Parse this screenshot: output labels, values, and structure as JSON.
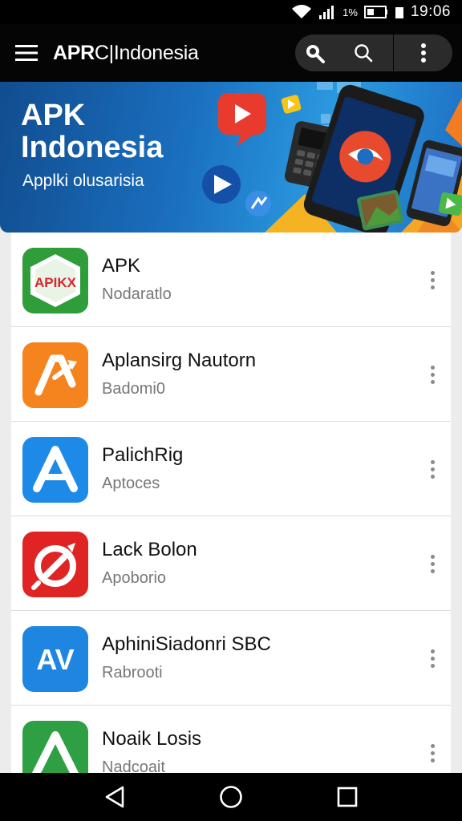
{
  "status_bar": {
    "battery_percent": "1%",
    "time": "19:06",
    "icons": [
      "wifi-icon",
      "signal-icon",
      "battery-icon"
    ]
  },
  "app_bar": {
    "title_bold": "APR",
    "title_sep": "C|",
    "title_rest": "Indonesia",
    "icons": [
      "menu-icon",
      "search-icon",
      "search-outline-icon",
      "more-vert-icon"
    ]
  },
  "banner": {
    "title_line1": "APK",
    "title_line2": "Indonesia",
    "subtitle": "Applki olusarisia"
  },
  "apps": [
    {
      "name": "APK",
      "subtitle": "Nodaratlo",
      "icon_text": "APIKX",
      "icon_color": "#2e9d3a"
    },
    {
      "name": "Aplansirg Nautorn",
      "subtitle": "Badomi0",
      "icon_text": "A",
      "icon_color": "#f5841f"
    },
    {
      "name": "PalichRig",
      "subtitle": "Aptoces",
      "icon_text": "A",
      "icon_color": "#1e8ae8"
    },
    {
      "name": "Lack Bolon",
      "subtitle": "Apoborio",
      "icon_text": "",
      "icon_color": "#e02424"
    },
    {
      "name": "AphiniSiadonri SBC",
      "subtitle": "Rabrooti",
      "icon_text": "AV",
      "icon_color": "#1e86e0"
    },
    {
      "name": "Noaik Losis",
      "subtitle": "Nadcoait",
      "icon_text": "A",
      "icon_color": "#2ea043"
    }
  ],
  "nav_bar": {
    "icons": [
      "back-icon",
      "home-icon",
      "recents-icon"
    ]
  }
}
